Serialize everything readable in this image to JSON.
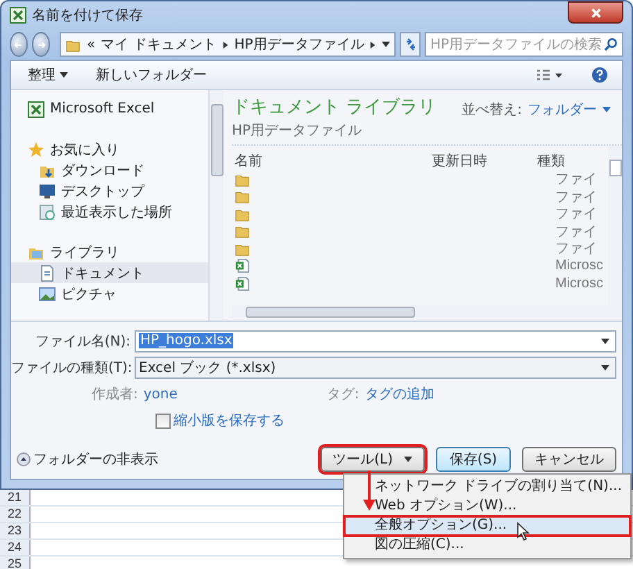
{
  "window": {
    "title": "名前を付けて保存"
  },
  "address_bar": {
    "overflow": "«",
    "path": [
      "マイ ドキュメント",
      "HP用データファイル"
    ]
  },
  "search": {
    "placeholder": "HP用データファイルの検索"
  },
  "toolbar": {
    "organize": "整理",
    "new_folder": "新しいフォルダー"
  },
  "nav": [
    {
      "label": "Microsoft Excel",
      "kind": "excel",
      "selected": false
    },
    {
      "label": "お気に入り",
      "kind": "star",
      "selected": false,
      "children": [
        {
          "label": "ダウンロード",
          "kind": "download",
          "selected": false
        },
        {
          "label": "デスクトップ",
          "kind": "desktop",
          "selected": false
        },
        {
          "label": "最近表示した場所",
          "kind": "recent",
          "selected": false
        }
      ]
    },
    {
      "label": "ライブラリ",
      "kind": "library",
      "selected": false,
      "children": [
        {
          "label": "ドキュメント",
          "kind": "document",
          "selected": true
        },
        {
          "label": "ピクチャ",
          "kind": "picture",
          "selected": false
        }
      ]
    }
  ],
  "library": {
    "title": "ドキュメント ライブラリ",
    "subtitle": "HP用データファイル",
    "sort_label": "並べ替え:",
    "sort_value": "フォルダー"
  },
  "columns": [
    "名前",
    "更新日時",
    "種類"
  ],
  "rows": [
    {
      "kind": "folder",
      "type": "ファイ"
    },
    {
      "kind": "folder",
      "type": "ファイ"
    },
    {
      "kind": "folder",
      "type": "ファイ"
    },
    {
      "kind": "folder",
      "type": "ファイ"
    },
    {
      "kind": "folder",
      "type": "ファイ"
    },
    {
      "kind": "excel",
      "type": "Microsc"
    },
    {
      "kind": "excel",
      "type": "Microsc"
    }
  ],
  "form": {
    "file_name_label": "ファイル名(N):",
    "file_name": "HP_hogo.xlsx",
    "file_type_label": "ファイルの種類(T):",
    "file_type": "Excel ブック (*.xlsx)",
    "author_label": "作成者:",
    "author": "yone",
    "tags_label": "タグ:",
    "tags": "タグの追加",
    "thumbnail": {
      "label": "縮小版を保存する",
      "checked": false
    }
  },
  "footer": {
    "hide_folders": "フォルダーの非表示",
    "buttons": [
      {
        "label": "ツール(L)",
        "kind": "menu",
        "highlighted": true
      },
      {
        "label": "保存(S)",
        "kind": "default",
        "highlighted": false
      },
      {
        "label": "キャンセル",
        "kind": "plain",
        "highlighted": false
      }
    ]
  },
  "menu": {
    "items": [
      {
        "label": "ネットワーク ドライブの割り当て(N)...",
        "selected": false
      },
      {
        "label": "Web オプション(W)...",
        "selected": false
      },
      {
        "label": "全般オプション(G)...",
        "selected": true
      },
      {
        "label": "図の圧縮(C)...",
        "selected": false
      }
    ]
  },
  "sheet": {
    "rows": [
      "21",
      "22",
      "23",
      "24",
      "25"
    ]
  }
}
